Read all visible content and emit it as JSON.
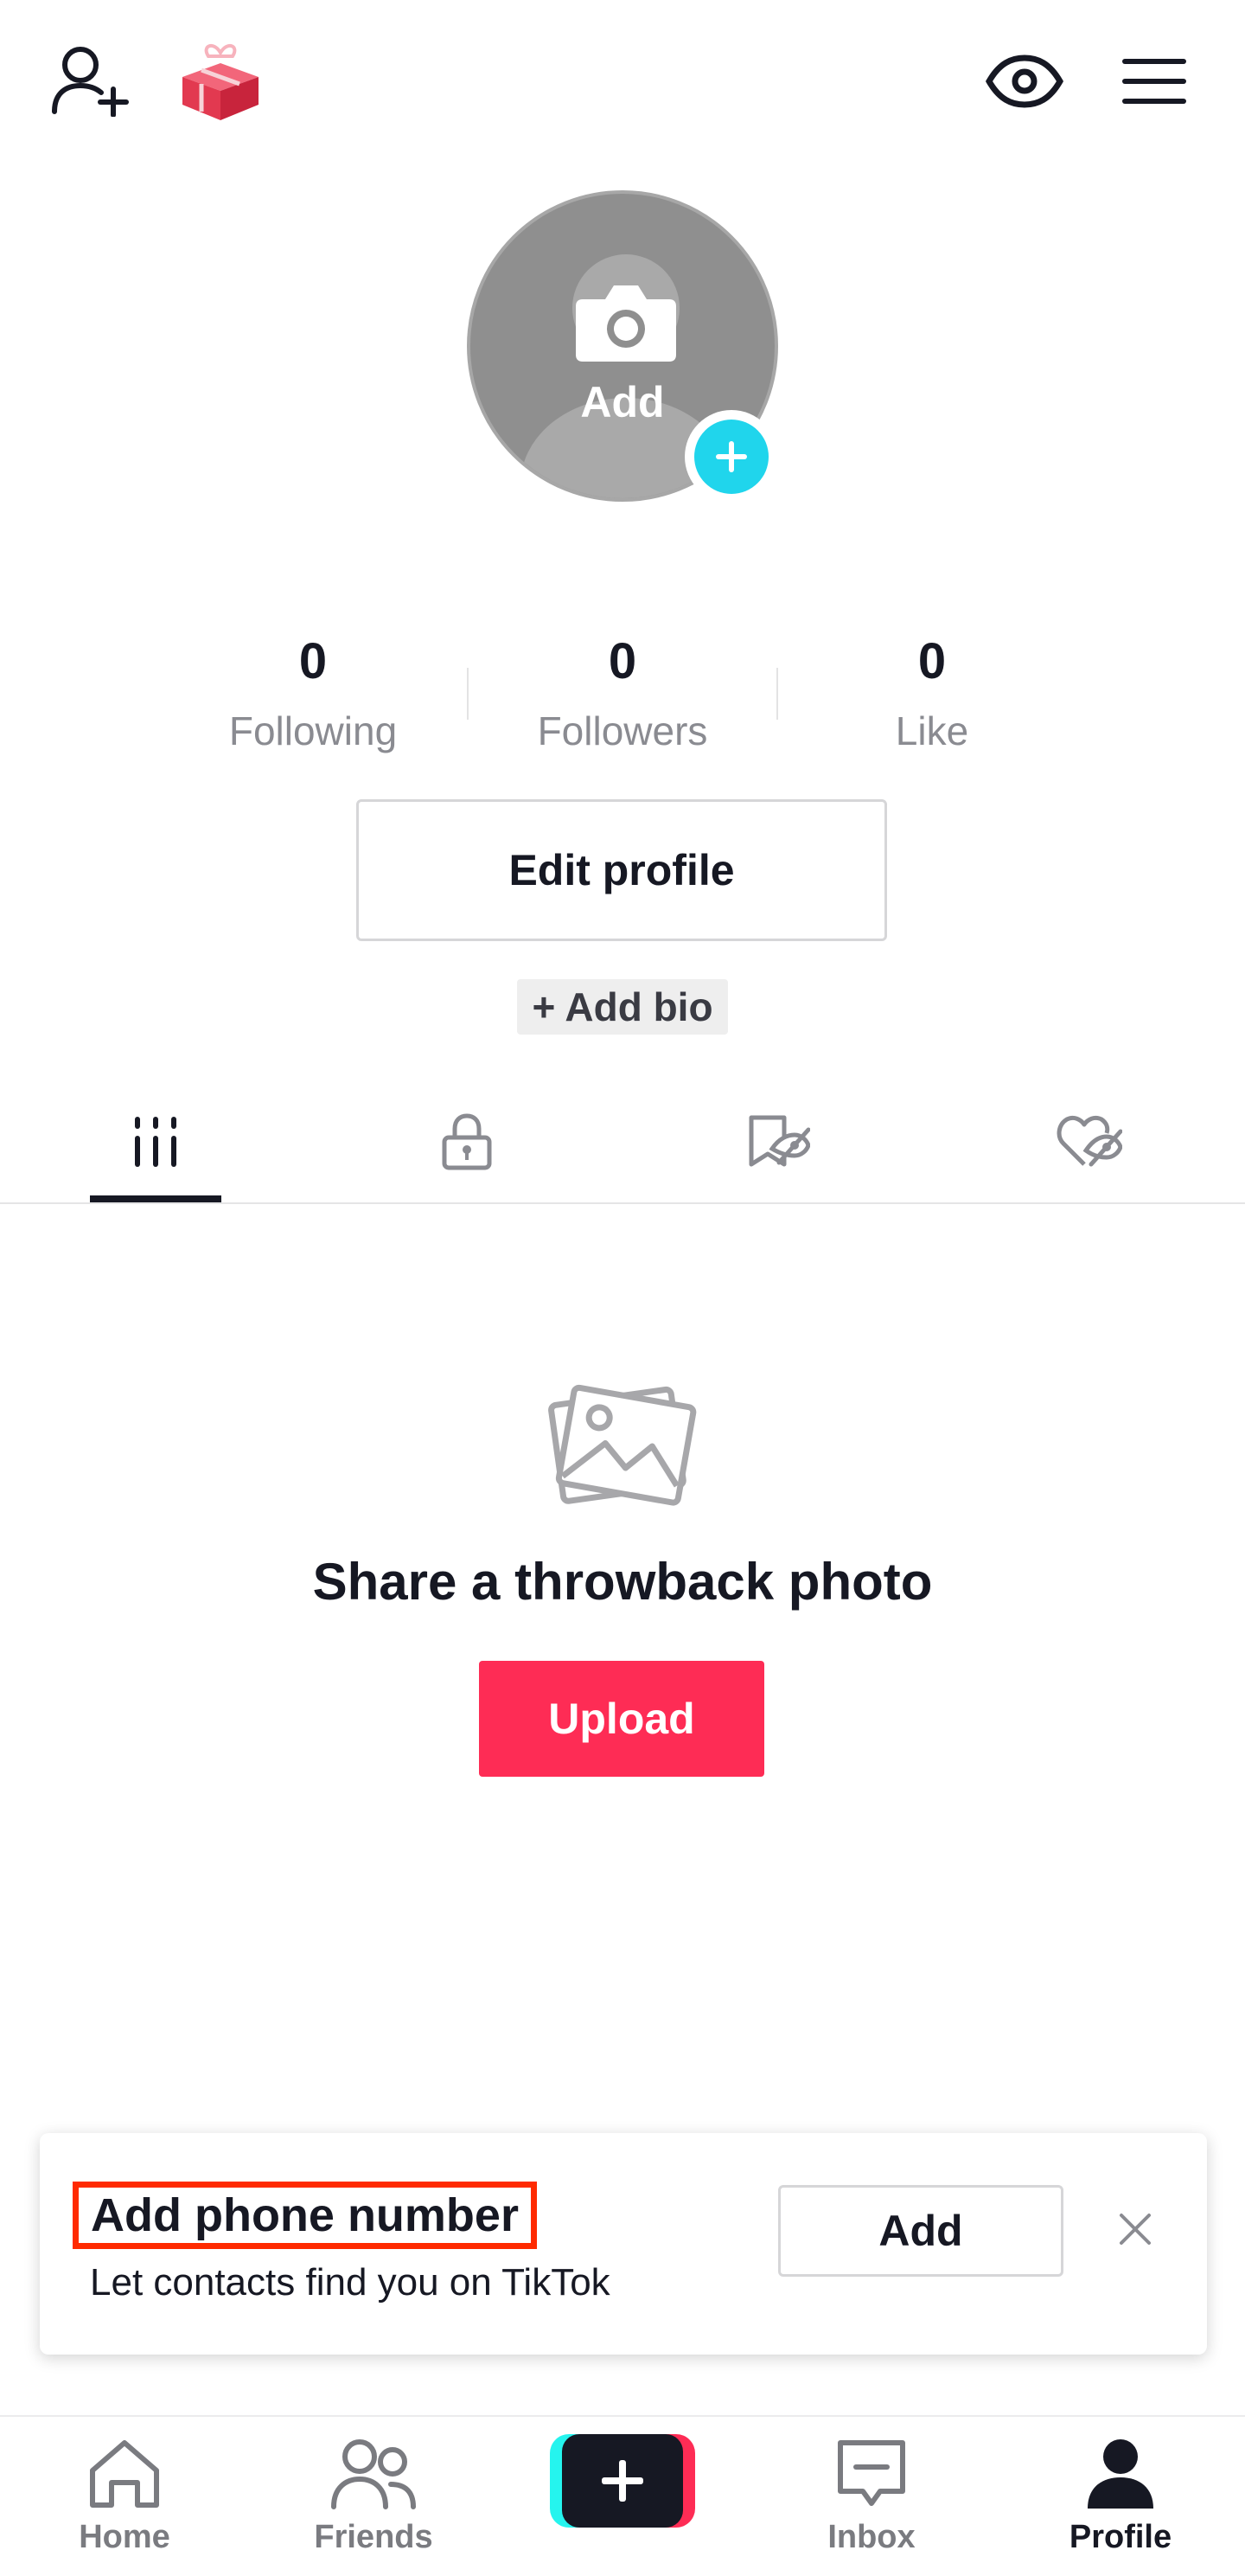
{
  "header": {
    "icons": [
      "add-friend-icon",
      "gift-icon",
      "eye-icon",
      "menu-icon"
    ]
  },
  "avatar": {
    "add_label": "Add"
  },
  "stats": {
    "following": {
      "value": "0",
      "label": "Following"
    },
    "followers": {
      "value": "0",
      "label": "Followers"
    },
    "likes": {
      "value": "0",
      "label": "Like"
    }
  },
  "profile_actions": {
    "edit_profile": "Edit profile",
    "add_bio": "+ Add bio"
  },
  "tabs": {
    "items": [
      "videos-grid-icon",
      "private-lock-icon",
      "reposts-hidden-icon",
      "liked-hidden-icon"
    ],
    "active": "videos-grid-icon"
  },
  "empty_state": {
    "title": "Share a throwback photo",
    "button": "Upload"
  },
  "phone_banner": {
    "title": "Add phone number",
    "subtitle": "Let contacts find you on TikTok",
    "button": "Add"
  },
  "bottom_nav": {
    "home": "Home",
    "friends": "Friends",
    "inbox": "Inbox",
    "profile": "Profile",
    "active": "Profile"
  },
  "colors": {
    "accent": "#fe2c55",
    "cyan": "#20d5ec",
    "text": "#161823",
    "muted": "#8a8b91",
    "highlight": "#ff2a00"
  }
}
